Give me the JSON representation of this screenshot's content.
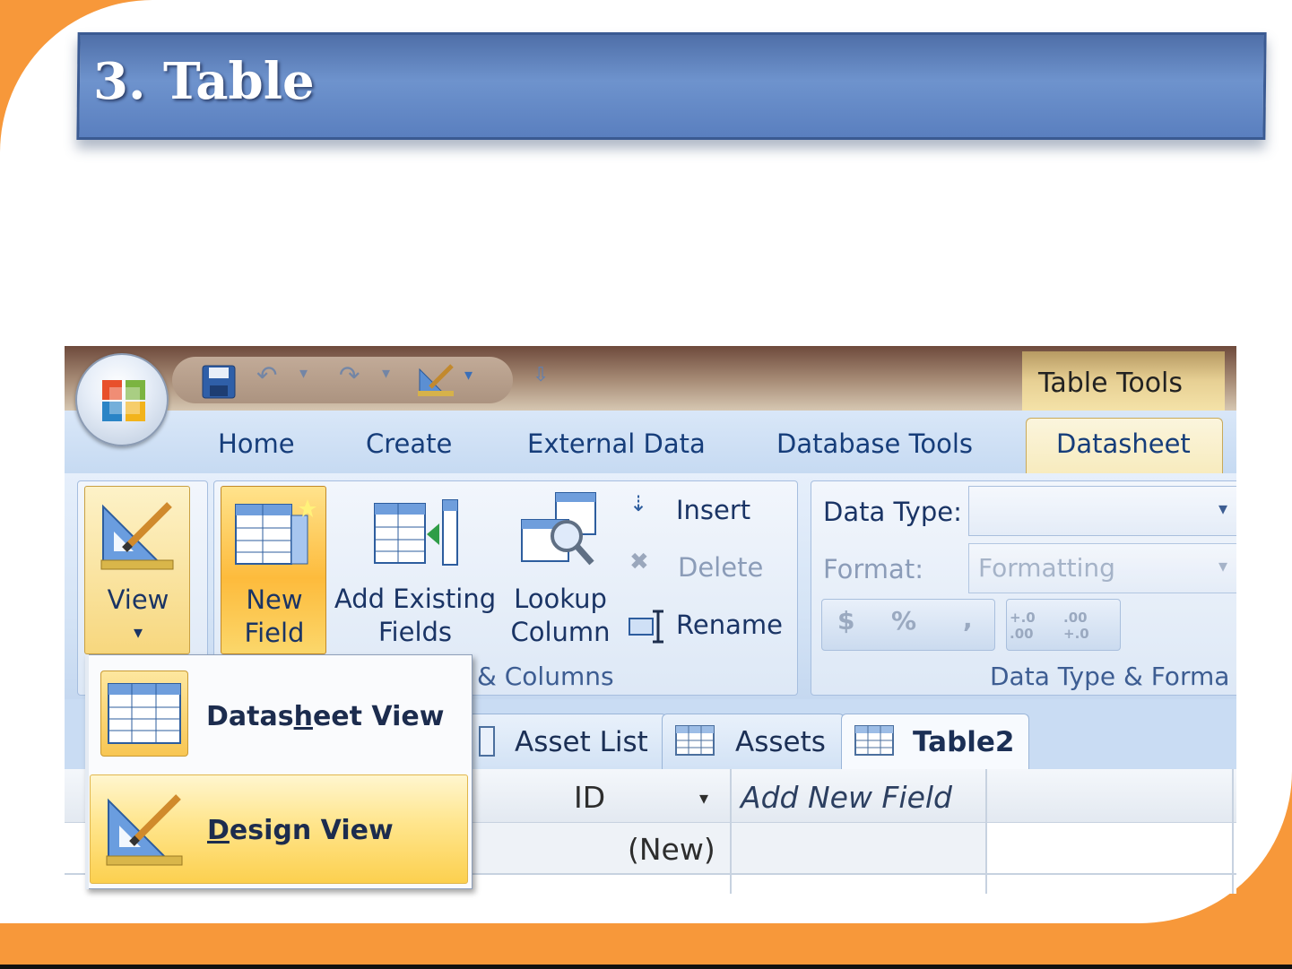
{
  "slide": {
    "title": "3. Table",
    "colors": {
      "accent": "#f7983a",
      "banner": "#5a7fbf",
      "background": "#ffffff"
    }
  },
  "app": {
    "contextual_tab_group": "Table Tools",
    "quick_access_icons": [
      "save-icon",
      "undo-icon",
      "redo-icon",
      "view-icon",
      "customize-icon"
    ],
    "tabs": [
      {
        "label": "Home",
        "active": false
      },
      {
        "label": "Create",
        "active": false
      },
      {
        "label": "External Data",
        "active": false
      },
      {
        "label": "Database Tools",
        "active": false
      },
      {
        "label": "Datasheet",
        "active": true
      }
    ]
  },
  "ribbon": {
    "view": {
      "label": "View",
      "arrow": "▾"
    },
    "fields_columns": {
      "new_field": {
        "line1": "New",
        "line2": "Field"
      },
      "add_existing": {
        "line1": "Add Existing",
        "line2": "Fields"
      },
      "lookup": {
        "line1": "Lookup",
        "line2": "Column"
      },
      "insert": "Insert",
      "delete": "Delete",
      "rename": "Rename",
      "group_label": "& Columns"
    },
    "data_type_format": {
      "data_type_label": "Data Type:",
      "data_type_value": "",
      "format_label": "Format:",
      "format_value": "Formatting",
      "buttons": [
        "$",
        "%",
        ",",
        "+.0 .00",
        ".00 +.0"
      ],
      "group_label": "Data Type & Forma"
    }
  },
  "documents": {
    "tabs": [
      {
        "label": "Asset List",
        "active": false
      },
      {
        "label": "Assets",
        "active": false
      },
      {
        "label": "Table2",
        "active": true
      }
    ]
  },
  "grid": {
    "columns": [
      "ID",
      "Add New Field"
    ],
    "new_row_value": "(New)"
  },
  "view_menu": {
    "items": [
      {
        "label_pre": "Datas",
        "label_key": "h",
        "label_post": "eet View",
        "highlighted": false
      },
      {
        "label_pre": "",
        "label_key": "D",
        "label_post": "esign View",
        "highlighted": true
      }
    ]
  }
}
